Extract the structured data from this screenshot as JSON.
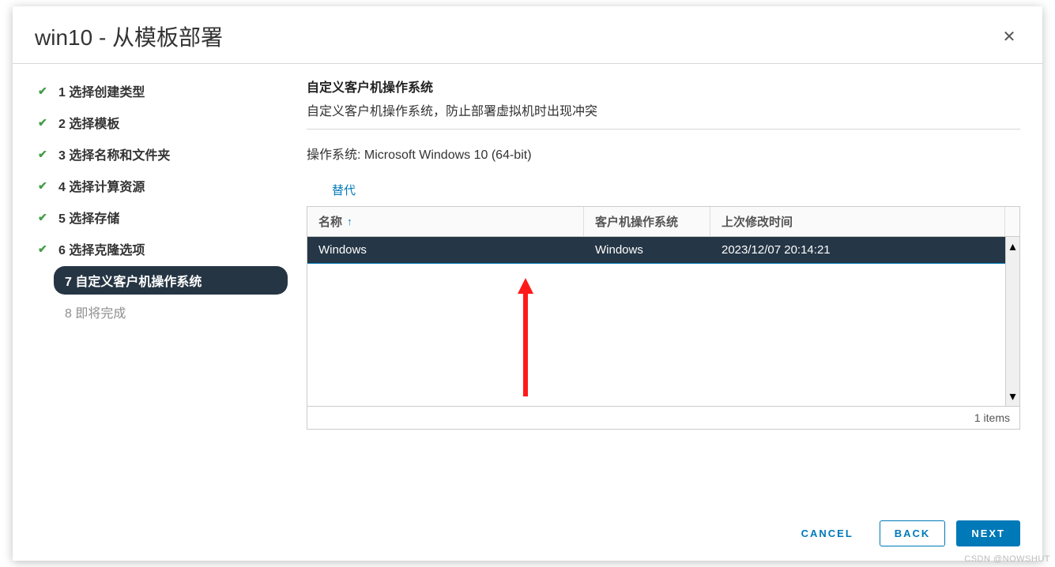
{
  "dialog": {
    "title": "win10 - 从模板部署",
    "close_glyph": "✕"
  },
  "steps": [
    {
      "num": "1",
      "label": "选择创建类型",
      "state": "done"
    },
    {
      "num": "2",
      "label": "选择模板",
      "state": "done"
    },
    {
      "num": "3",
      "label": "选择名称和文件夹",
      "state": "done"
    },
    {
      "num": "4",
      "label": "选择计算资源",
      "state": "done"
    },
    {
      "num": "5",
      "label": "选择存储",
      "state": "done"
    },
    {
      "num": "6",
      "label": "选择克隆选项",
      "state": "done"
    },
    {
      "num": "7",
      "label": "自定义客户机操作系统",
      "state": "current"
    },
    {
      "num": "8",
      "label": "即将完成",
      "state": "disabled"
    }
  ],
  "content": {
    "title": "自定义客户机操作系统",
    "desc": "自定义客户机操作系统，防止部署虚拟机时出现冲突",
    "os_label": "操作系统:",
    "os_value": "Microsoft Windows 10 (64-bit)",
    "replace_label": "替代"
  },
  "table": {
    "columns": {
      "name": "名称",
      "guest_os": "客户机操作系统",
      "modified": "上次修改时间"
    },
    "sort_glyph": "↑",
    "rows": [
      {
        "name": "Windows",
        "guest_os": "Windows",
        "modified": "2023/12/07 20:14:21"
      }
    ],
    "footer": "1 items"
  },
  "footer": {
    "cancel": "CANCEL",
    "back": "BACK",
    "next": "NEXT"
  },
  "watermark": "CSDN @NOWSHUT"
}
